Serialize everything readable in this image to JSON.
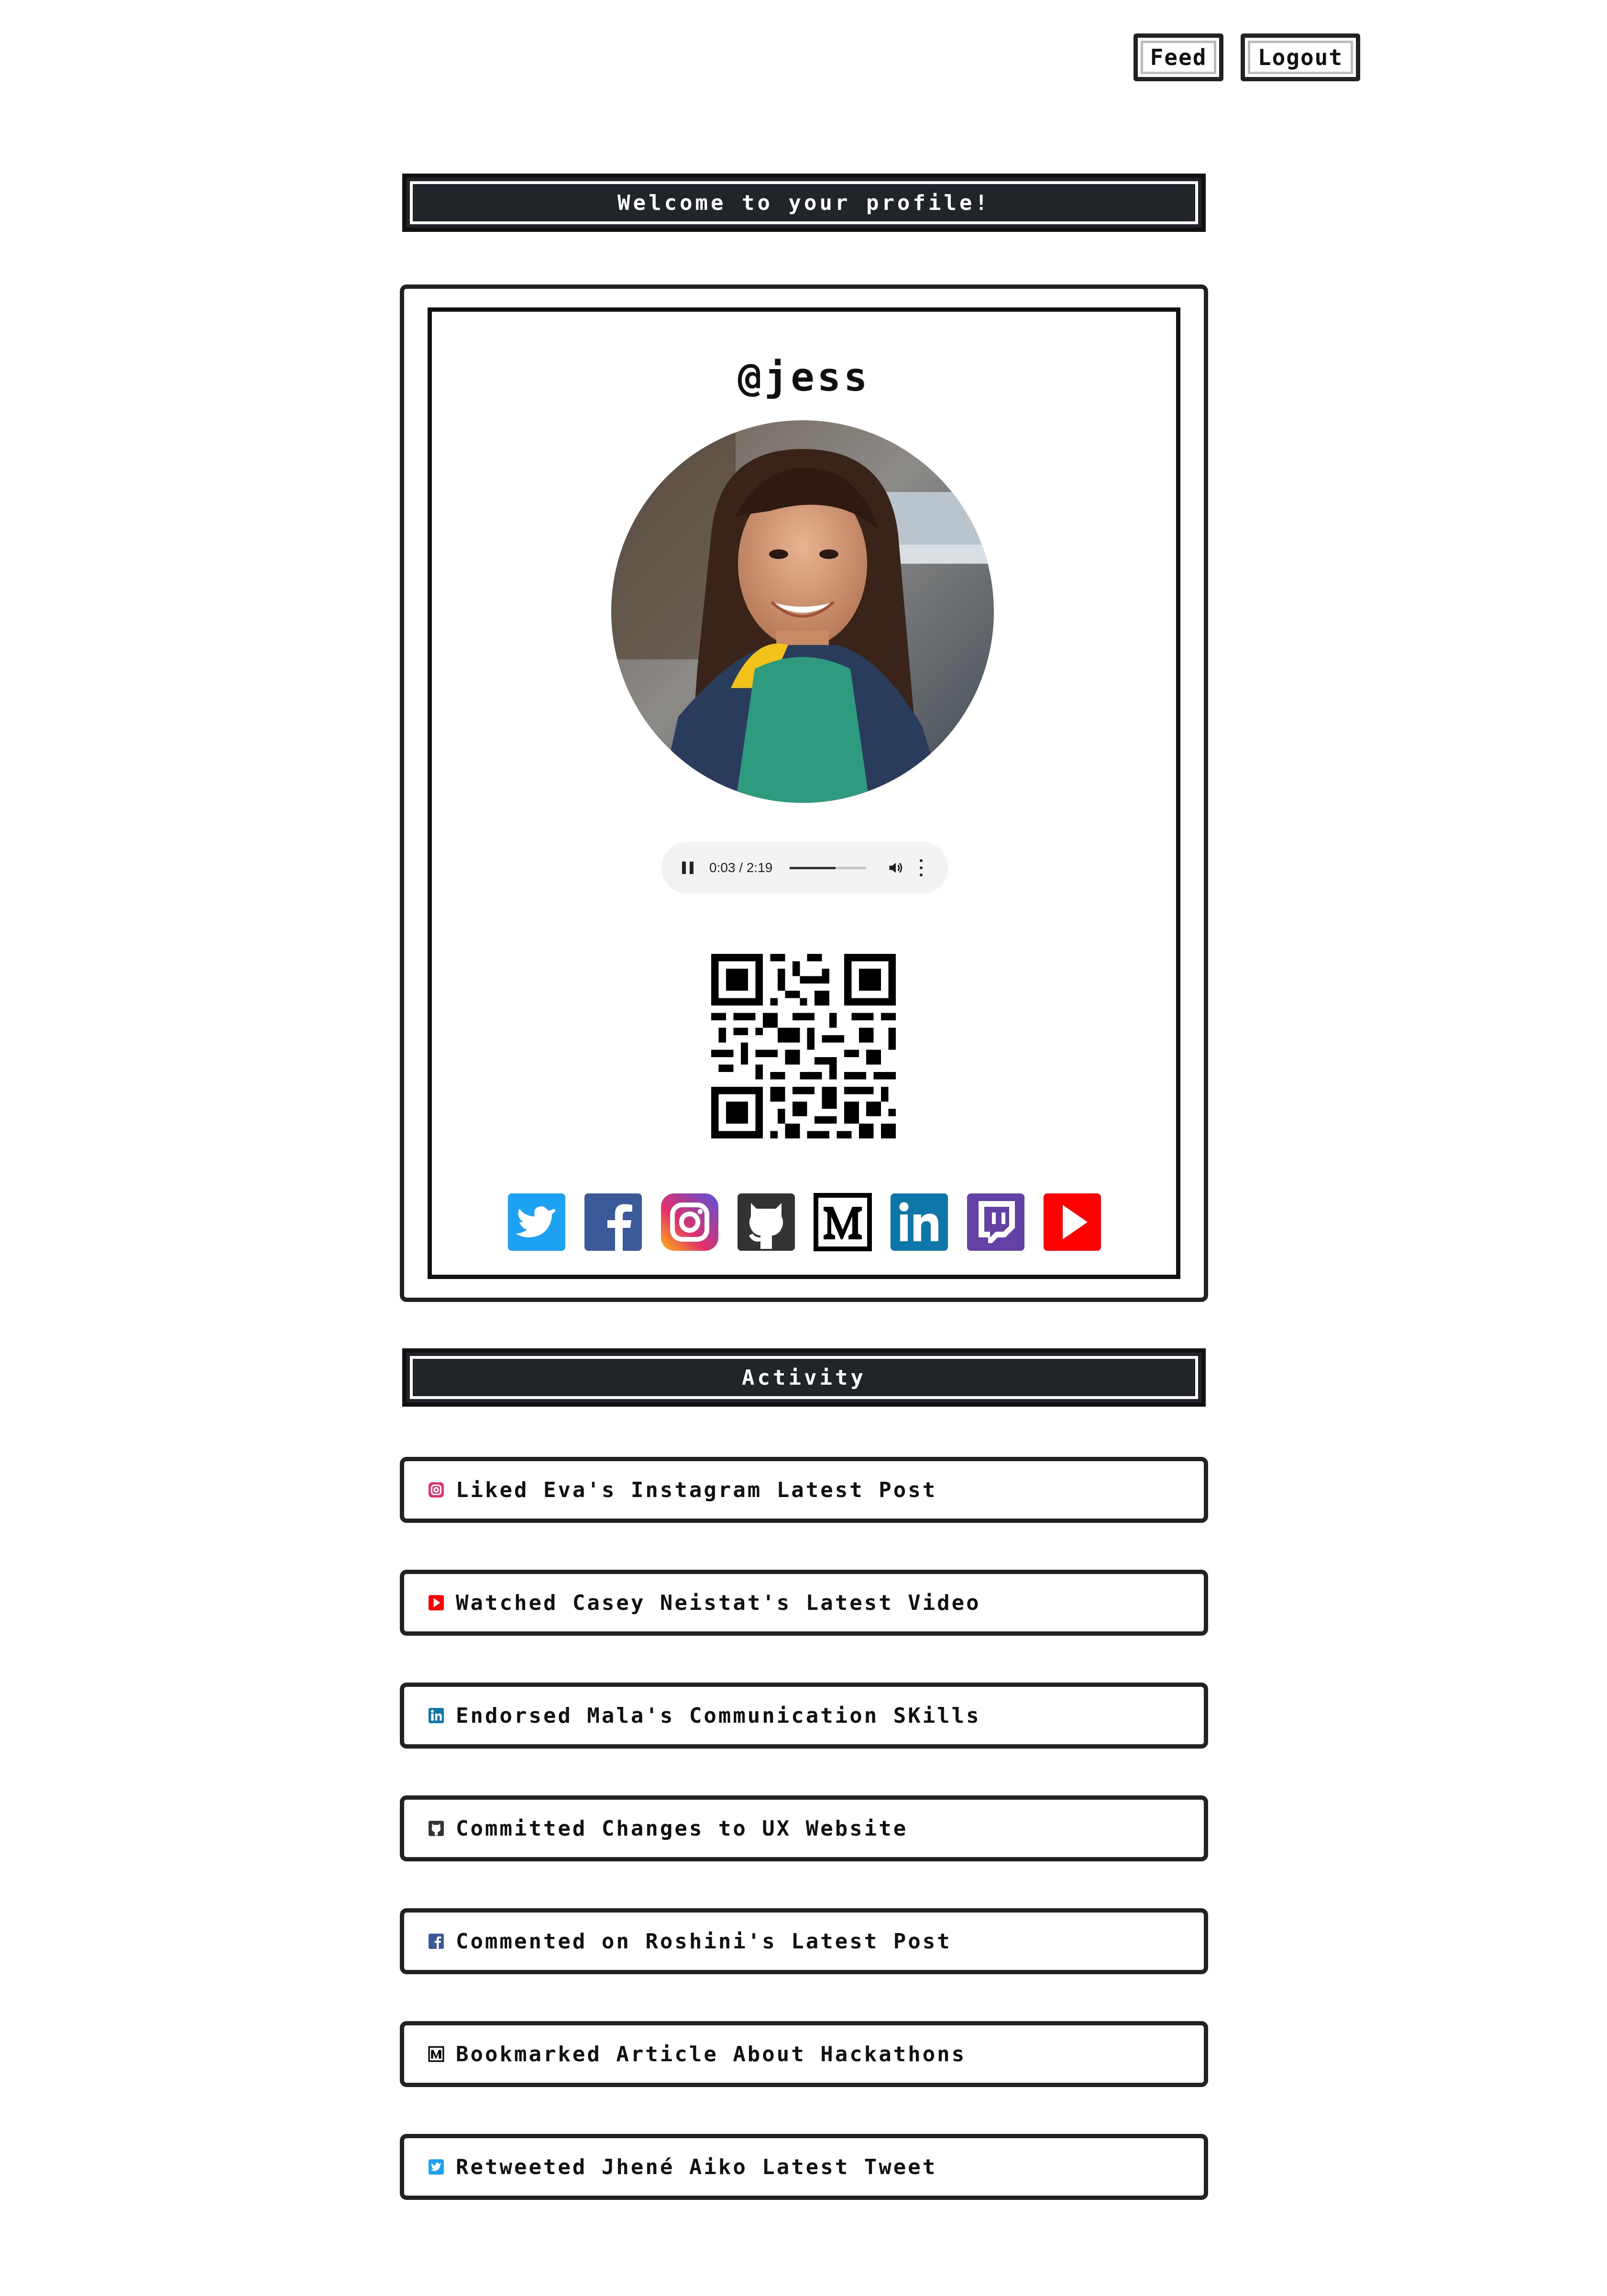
{
  "nav": {
    "feed_label": "Feed",
    "logout_label": "Logout"
  },
  "header": {
    "title": "Welcome to your profile!"
  },
  "profile": {
    "username": "@jess",
    "audio": {
      "time": "0:03 / 2:19",
      "progress": 0.022
    },
    "socials": [
      {
        "name": "twitter-icon",
        "color": "#1da1f2"
      },
      {
        "name": "facebook-icon",
        "color": "#3b5998"
      },
      {
        "name": "instagram-icon",
        "color": "#c13584"
      },
      {
        "name": "github-icon",
        "color": "#333333"
      },
      {
        "name": "medium-icon",
        "color": "#000000"
      },
      {
        "name": "linkedin-icon",
        "color": "#0e76a8"
      },
      {
        "name": "twitch-icon",
        "color": "#6441a5"
      },
      {
        "name": "youtube-icon",
        "color": "#ff0000"
      }
    ]
  },
  "activity": {
    "title": "Activity",
    "items": [
      {
        "icon": "instagram-icon",
        "text": "Liked Eva's Instagram Latest Post"
      },
      {
        "icon": "youtube-icon",
        "text": "Watched Casey Neistat's Latest Video"
      },
      {
        "icon": "linkedin-icon",
        "text": "Endorsed Mala's Communication SKills"
      },
      {
        "icon": "github-icon",
        "text": "Committed Changes to UX Website"
      },
      {
        "icon": "facebook-icon",
        "text": "Commented on Roshini's Latest Post"
      },
      {
        "icon": "medium-icon",
        "text": "Bookmarked Article About Hackathons"
      },
      {
        "icon": "twitter-icon",
        "text": "Retweeted Jhené Aiko Latest Tweet"
      }
    ]
  }
}
